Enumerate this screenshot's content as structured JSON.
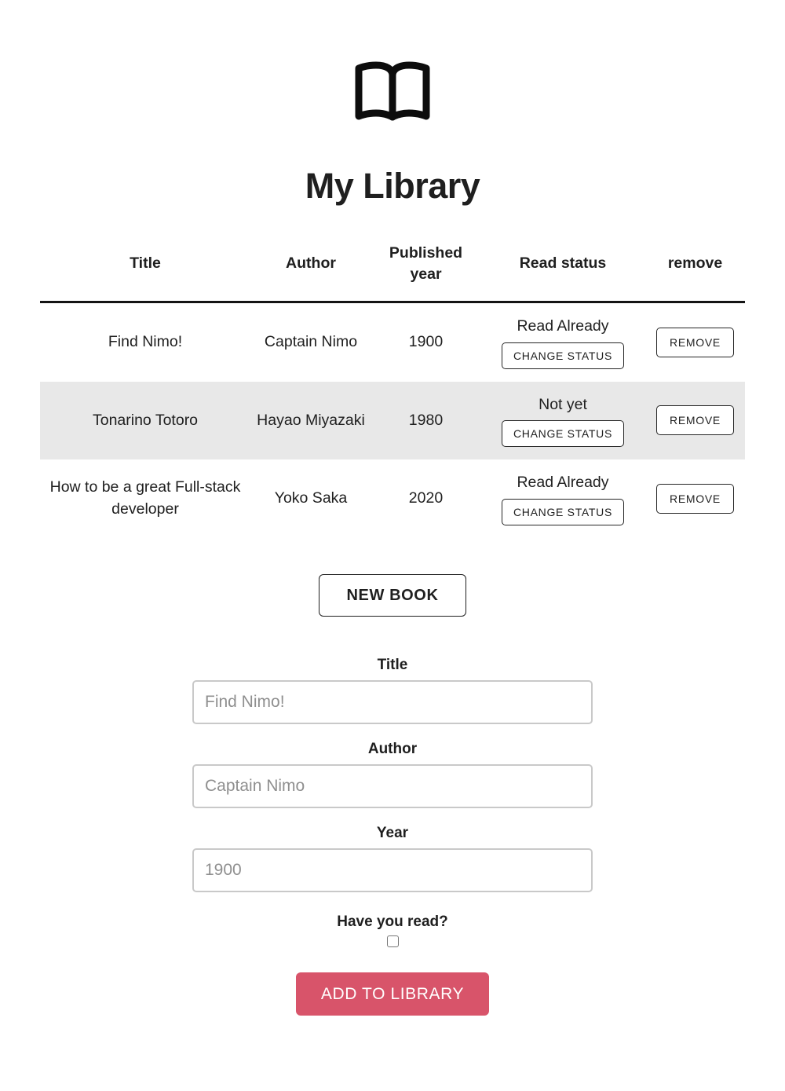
{
  "header": {
    "icon": "open-book-icon",
    "title": "My Library"
  },
  "table": {
    "columns": [
      "Title",
      "Author",
      "Published year",
      "Read status",
      "remove"
    ],
    "change_status_label": "CHANGE STATUS",
    "remove_label": "REMOVE",
    "rows": [
      {
        "title": "Find Nimo!",
        "author": "Captain Nimo",
        "year": "1900",
        "status": "Read Already",
        "shaded": false
      },
      {
        "title": "Tonarino Totoro",
        "author": "Hayao Miyazaki",
        "year": "1980",
        "status": "Not yet",
        "shaded": true
      },
      {
        "title": "How to be a great Full-stack developer",
        "author": "Yoko Saka",
        "year": "2020",
        "status": "Read Already",
        "shaded": false
      }
    ]
  },
  "new_book_button": {
    "label": "NEW BOOK"
  },
  "form": {
    "title_label": "Title",
    "title_placeholder": "Find Nimo!",
    "title_value": "",
    "author_label": "Author",
    "author_placeholder": "Captain Nimo",
    "author_value": "",
    "year_label": "Year",
    "year_placeholder": "1900",
    "year_value": "",
    "read_label": "Have you read?",
    "read_checked": false,
    "submit_label": "ADD TO LIBRARY"
  },
  "colors": {
    "accent": "#d8546a",
    "row_shade": "#e8e8e8",
    "text": "#1f1f1f",
    "input_border": "#c9c9c9",
    "placeholder": "#8f8f8f"
  }
}
